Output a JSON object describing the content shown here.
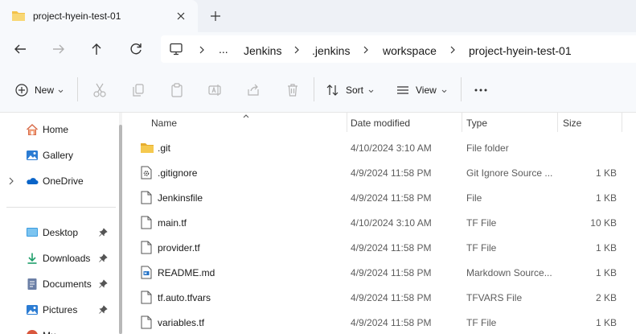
{
  "tab": {
    "title": "project-hyein-test-01"
  },
  "breadcrumb": [
    "...",
    "Jenkins",
    ".jenkins",
    "workspace",
    "project-hyein-test-01"
  ],
  "toolbar": {
    "new_label": "New",
    "sort_label": "Sort",
    "view_label": "View"
  },
  "sidebar": {
    "top_items": [
      {
        "label": "Home",
        "icon": "home-icon"
      },
      {
        "label": "Gallery",
        "icon": "gallery-icon"
      },
      {
        "label": "OneDrive",
        "icon": "onedrive-icon"
      }
    ],
    "quick_access": [
      {
        "label": "Desktop",
        "icon": "desktop-icon"
      },
      {
        "label": "Downloads",
        "icon": "downloads-icon"
      },
      {
        "label": "Documents",
        "icon": "documents-icon"
      },
      {
        "label": "Pictures",
        "icon": "pictures-icon"
      },
      {
        "label": "Mu",
        "icon": "music-icon"
      }
    ]
  },
  "columns": {
    "name": "Name",
    "date": "Date modified",
    "type": "Type",
    "size": "Size"
  },
  "files": [
    {
      "name": ".git",
      "date": "4/10/2024 3:10 AM",
      "type": "File folder",
      "size": "",
      "icon": "folder-icon"
    },
    {
      "name": ".gitignore",
      "date": "4/9/2024 11:58 PM",
      "type": "Git Ignore Source ...",
      "size": "1 KB",
      "icon": "gear-file-icon"
    },
    {
      "name": "Jenkinsfile",
      "date": "4/9/2024 11:58 PM",
      "type": "File",
      "size": "1 KB",
      "icon": "file-icon"
    },
    {
      "name": "main.tf",
      "date": "4/10/2024 3:10 AM",
      "type": "TF File",
      "size": "10 KB",
      "icon": "file-icon"
    },
    {
      "name": "provider.tf",
      "date": "4/9/2024 11:58 PM",
      "type": "TF File",
      "size": "1 KB",
      "icon": "file-icon"
    },
    {
      "name": "README.md",
      "date": "4/9/2024 11:58 PM",
      "type": "Markdown Source...",
      "size": "1 KB",
      "icon": "markdown-file-icon"
    },
    {
      "name": "tf.auto.tfvars",
      "date": "4/9/2024 11:58 PM",
      "type": "TFVARS File",
      "size": "2 KB",
      "icon": "file-icon"
    },
    {
      "name": "variables.tf",
      "date": "4/9/2024 11:58 PM",
      "type": "TF File",
      "size": "1 KB",
      "icon": "file-icon"
    }
  ],
  "colors": {
    "accent": "#0067c0",
    "folder": "#f3c24a",
    "chrome": "#eef1f6",
    "panel": "#f7f9fc"
  }
}
